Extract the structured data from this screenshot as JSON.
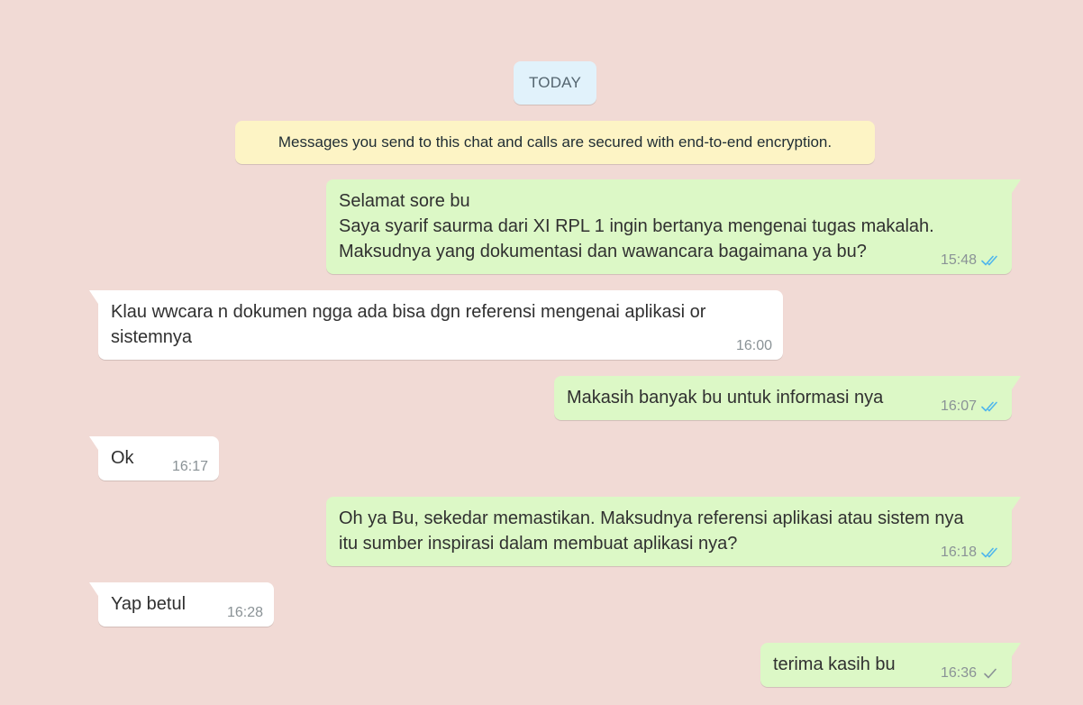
{
  "date_chip": "TODAY",
  "encryption_notice": "Messages you send to this chat and calls are secured with end-to-end encryption.",
  "colors": {
    "wallpaper": "#f1dad5",
    "outgoing_bubble": "#dcf8c6",
    "incoming_bubble": "#ffffff",
    "read_tick": "#4fb6ec",
    "sent_tick": "#8a9296"
  },
  "messages": [
    {
      "direction": "outgoing",
      "text": "Selamat sore bu\nSaya syarif saurma dari XI RPL 1 ingin bertanya mengenai tugas makalah.\nMaksudnya yang dokumentasi dan wawancara bagaimana ya bu?",
      "time": "15:48",
      "status_icon": "double-check-read-icon"
    },
    {
      "direction": "incoming",
      "text": "Klau wwcara n dokumen ngga ada bisa dgn referensi mengenai aplikasi or\nsistemnya",
      "time": "16:00"
    },
    {
      "direction": "outgoing",
      "text": "Makasih banyak bu untuk informasi nya",
      "time": "16:07",
      "status_icon": "double-check-read-icon"
    },
    {
      "direction": "incoming",
      "text": "Ok",
      "time": "16:17"
    },
    {
      "direction": "outgoing",
      "text": "Oh ya Bu, sekedar memastikan. Maksudnya referensi aplikasi atau sistem nya\nitu sumber inspirasi dalam membuat aplikasi nya?",
      "time": "16:18",
      "status_icon": "double-check-read-icon"
    },
    {
      "direction": "incoming",
      "text": "Yap betul",
      "time": "16:28"
    },
    {
      "direction": "outgoing",
      "text": "terima kasih bu",
      "time": "16:36",
      "status_icon": "single-check-sent-icon"
    }
  ]
}
